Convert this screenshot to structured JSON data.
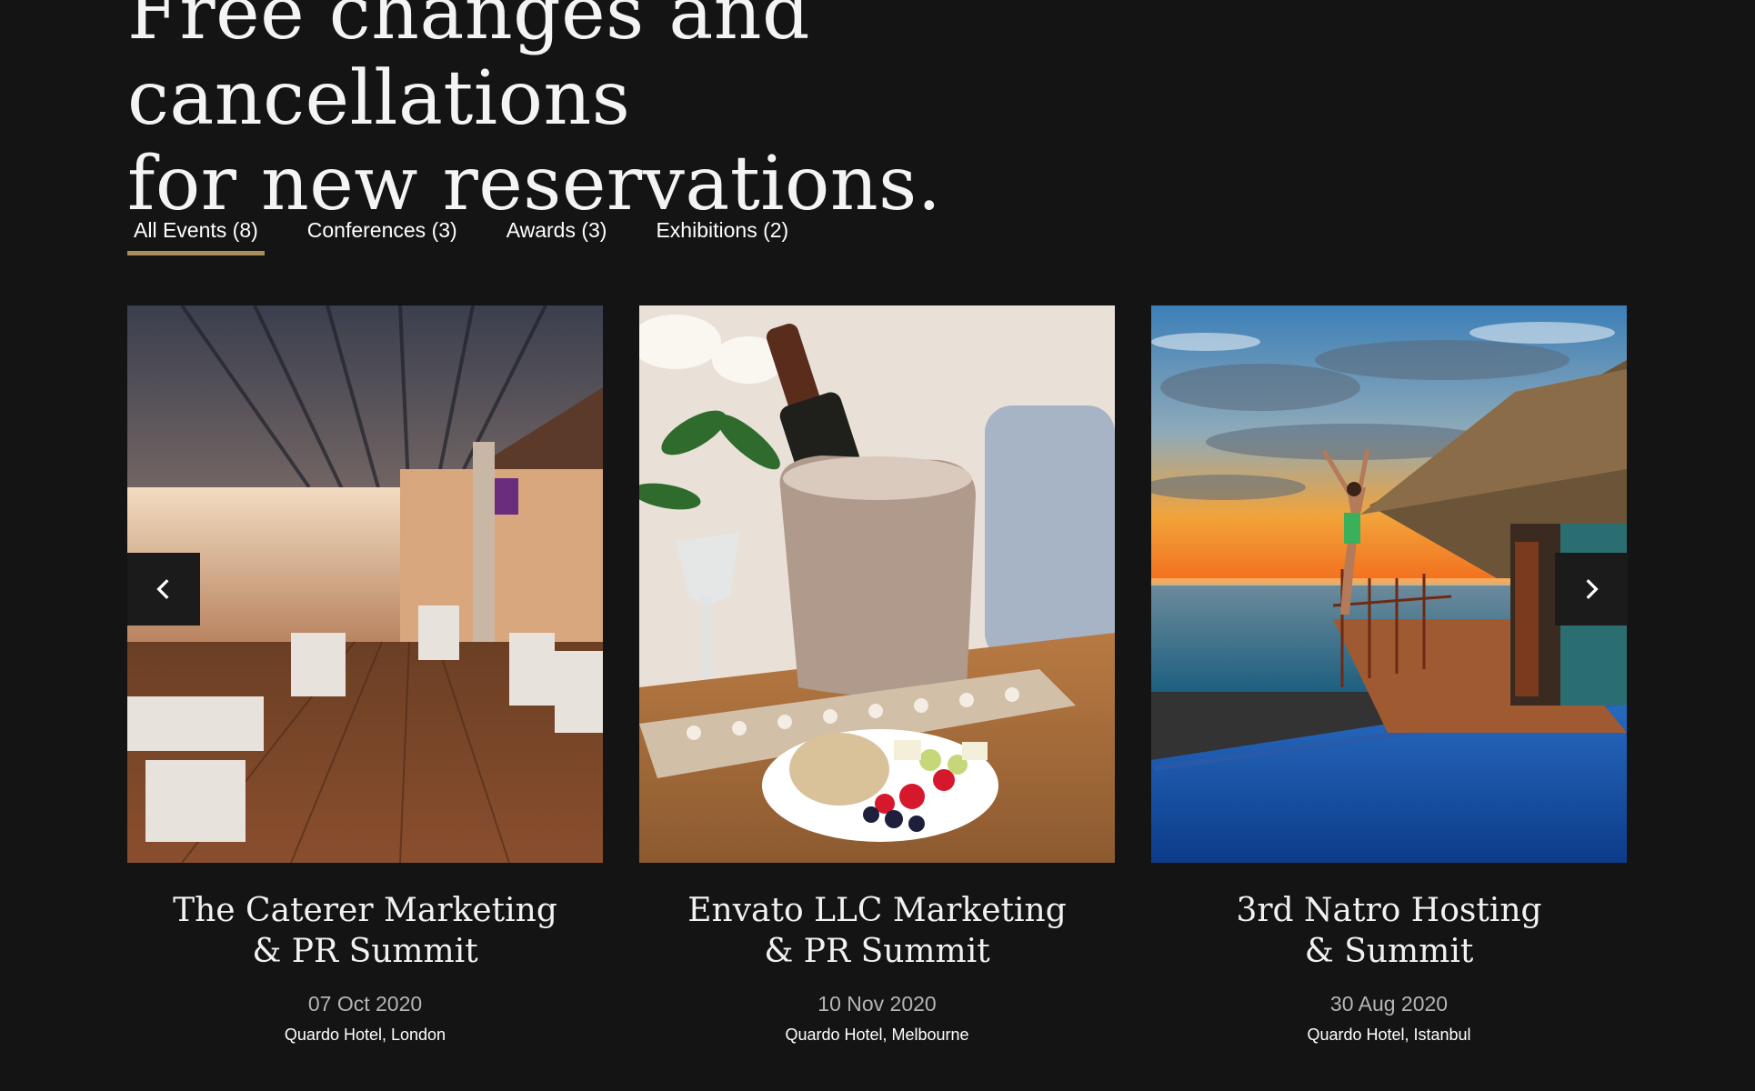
{
  "headline": "Free changes and cancellations\nfor new reservations.",
  "filters": [
    {
      "label": "All Events (8)",
      "active": true
    },
    {
      "label": "Conferences (3)",
      "active": false
    },
    {
      "label": "Awards (3)",
      "active": false
    },
    {
      "label": "Exhibitions (2)",
      "active": false
    }
  ],
  "events": [
    {
      "title": "The Caterer Marketing\n& PR Summit",
      "date": "07 Oct 2020",
      "venue": "Quardo Hotel, London",
      "image": "restaurant-interior-photo"
    },
    {
      "title": "Envato LLC Marketing\n& PR Summit",
      "date": "10 Nov 2020",
      "venue": "Quardo Hotel, Melbourne",
      "image": "champagne-and-fruit-photo"
    },
    {
      "title": "3rd Natro Hosting\n& Summit",
      "date": "30 Aug 2020",
      "venue": "Quardo Hotel, Istanbul",
      "image": "ocean-villa-sunset-photo"
    }
  ],
  "icons": {
    "prev": "chevron-left-icon",
    "next": "chevron-right-icon"
  },
  "colors": {
    "background": "#141414",
    "accent": "#a88f5d"
  }
}
